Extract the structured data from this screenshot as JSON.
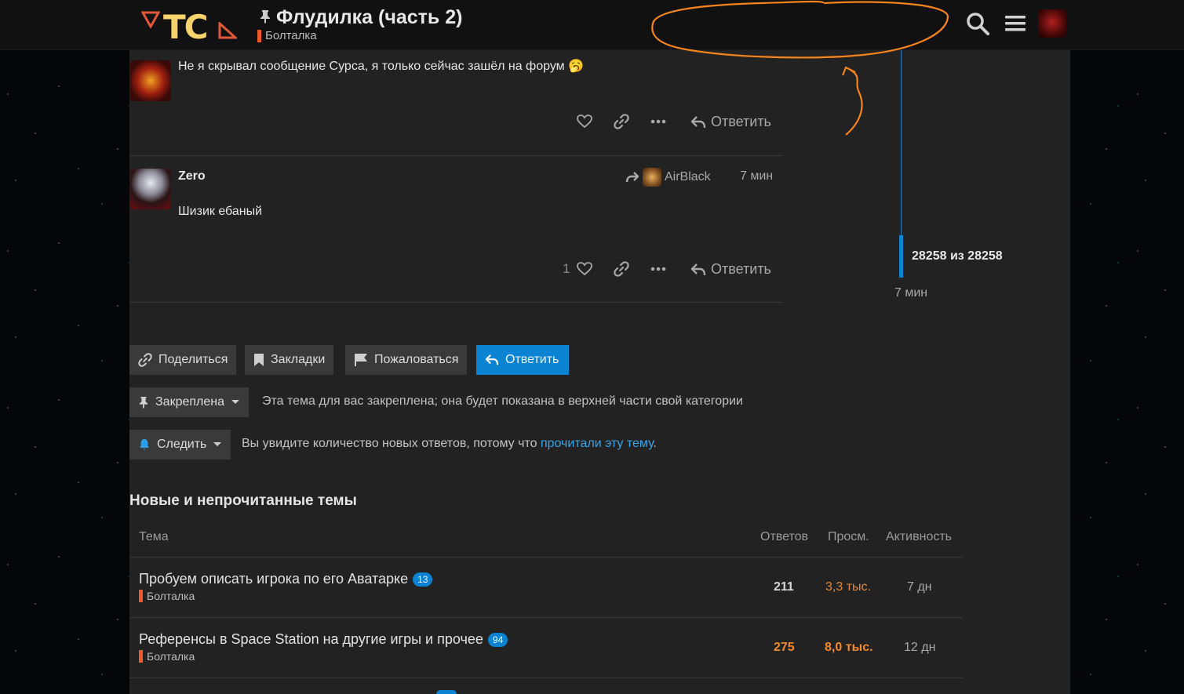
{
  "header": {
    "logo_text": "TC",
    "topic_title": "Флудилка (часть 2)",
    "category": "Болталка",
    "icons": [
      "search-icon",
      "hamburger-menu-icon",
      "user-avatar"
    ],
    "accent_color": "#f1592a"
  },
  "posts": [
    {
      "text": "Не я скрывал сообщение Сурса, я только сейчас зашёл на форум",
      "emoji": "🥱",
      "like_count": "",
      "reply_label": "Ответить"
    },
    {
      "username": "Zero",
      "reply_to": "AirBlack",
      "time": "7 мин",
      "text": "Шизик ебаный",
      "like_count": "1",
      "reply_label": "Ответить"
    }
  ],
  "timeline": {
    "position": "28258 из 28258",
    "time": "7 мин"
  },
  "footer_buttons": {
    "share": "Поделиться",
    "bookmarks": "Закладки",
    "flag": "Пожаловаться",
    "reply": "Ответить"
  },
  "notifications": {
    "pinned_label": "Закреплена",
    "pinned_text": "Эта тема для вас закреплена; она будет показана в верхней части свой категории",
    "watching_label": "Следить",
    "watching_text": "Вы увидите количество новых ответов, потому что ",
    "watching_link": "прочитали эту тему",
    "watching_tail": "."
  },
  "suggested": {
    "heading": "Новые и непрочитанные темы",
    "columns": [
      "Тема",
      "Ответов",
      "Просм.",
      "Активность"
    ],
    "rows": [
      {
        "title": "Пробуем описать игрока по его Аватарке",
        "unread": "13",
        "category": "Болталка",
        "replies": "211",
        "views": "3,3 тыс.",
        "activity": "7 дн",
        "replies_color": "#d6d6d6",
        "views_color": "#e0883b"
      },
      {
        "title": "Референсы в Space Station на другие игры и прочее",
        "unread": "94",
        "category": "Болталка",
        "replies": "275",
        "views": "8,0 тыс.",
        "activity": "12 дн",
        "replies_color": "#f08a2c",
        "views_color": "#f08a2c"
      }
    ]
  },
  "annotation_color": "#f5841f"
}
